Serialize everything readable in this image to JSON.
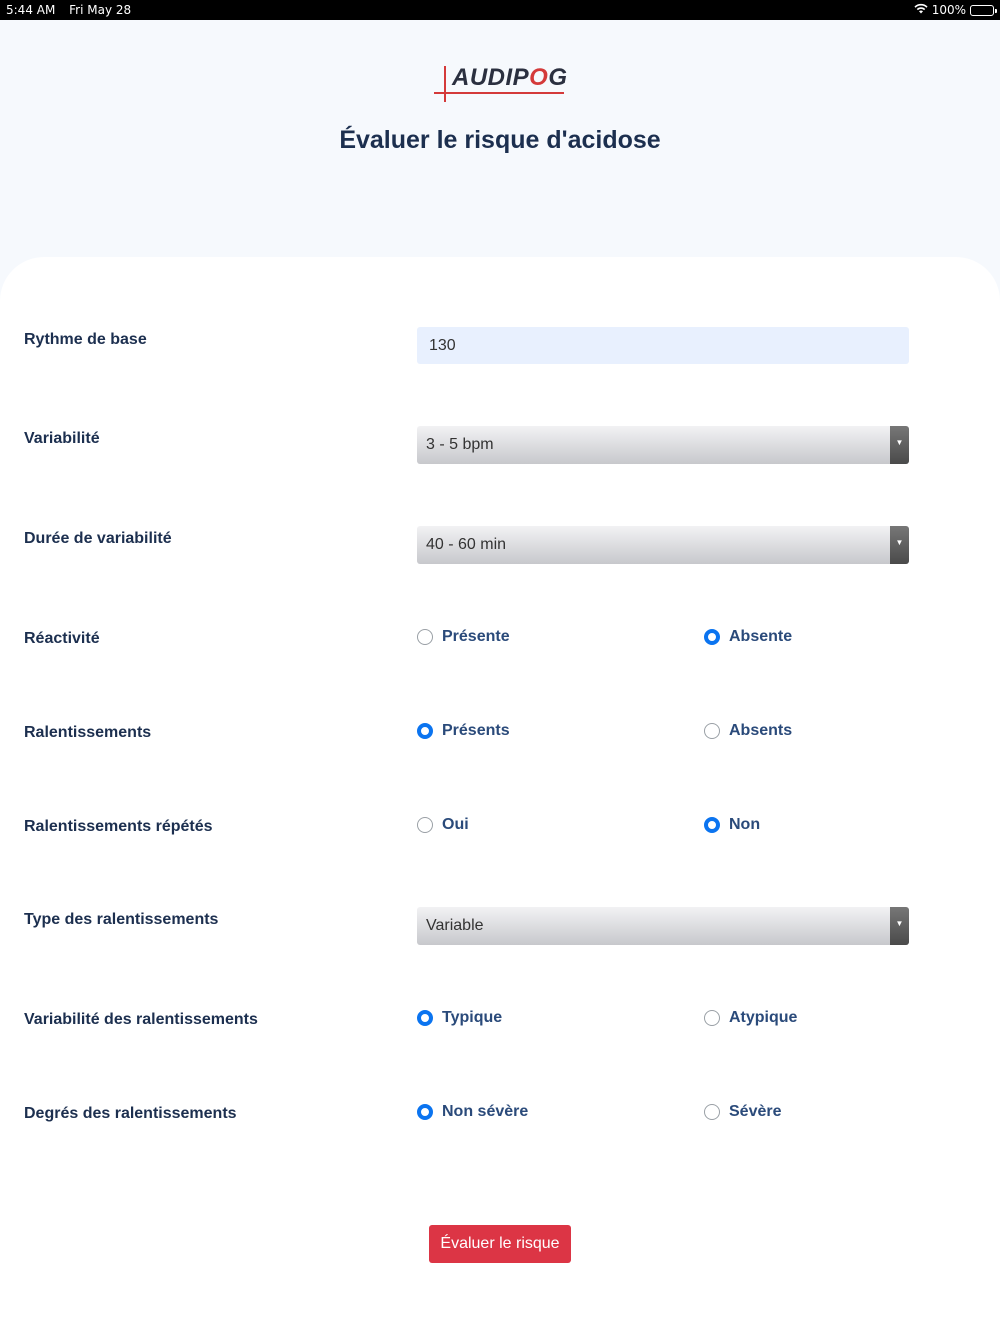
{
  "status_bar": {
    "time": "5:44 AM",
    "date": "Fri May 28",
    "battery": "100%",
    "wifi_icon": "wifi-icon",
    "battery_icon": "battery-icon"
  },
  "logo": {
    "text_pre": "AUDIP",
    "text_o": "O",
    "text_post": "G"
  },
  "page": {
    "title": "Évaluer le risque d'acidose"
  },
  "form": {
    "rythme": {
      "label": "Rythme de base",
      "value": "130"
    },
    "variabilite": {
      "label": "Variabilité",
      "selected": "3 - 5 bpm"
    },
    "duree": {
      "label": "Durée de variabilité",
      "selected": "40 - 60 min"
    },
    "reactivite": {
      "label": "Réactivité",
      "options": [
        {
          "label": "Présente",
          "checked": false
        },
        {
          "label": "Absente",
          "checked": true
        }
      ]
    },
    "ralentissements": {
      "label": "Ralentissements",
      "options": [
        {
          "label": "Présents",
          "checked": true
        },
        {
          "label": "Absents",
          "checked": false
        }
      ]
    },
    "repetes": {
      "label": "Ralentissements répétés",
      "options": [
        {
          "label": "Oui",
          "checked": false
        },
        {
          "label": "Non",
          "checked": true
        }
      ]
    },
    "type": {
      "label": "Type des ralentissements",
      "selected": "Variable"
    },
    "variabilite_ral": {
      "label": "Variabilité des ralentissements",
      "options": [
        {
          "label": "Typique",
          "checked": true
        },
        {
          "label": "Atypique",
          "checked": false
        }
      ]
    },
    "degres": {
      "label": "Degrés des ralentissements",
      "options": [
        {
          "label": "Non sévère",
          "checked": true
        },
        {
          "label": "Sévère",
          "checked": false
        }
      ]
    },
    "submit_label": "Évaluer le risque"
  },
  "colors": {
    "accent": "#0b74f0",
    "button": "#dc3545",
    "title": "#1c2f4f"
  }
}
